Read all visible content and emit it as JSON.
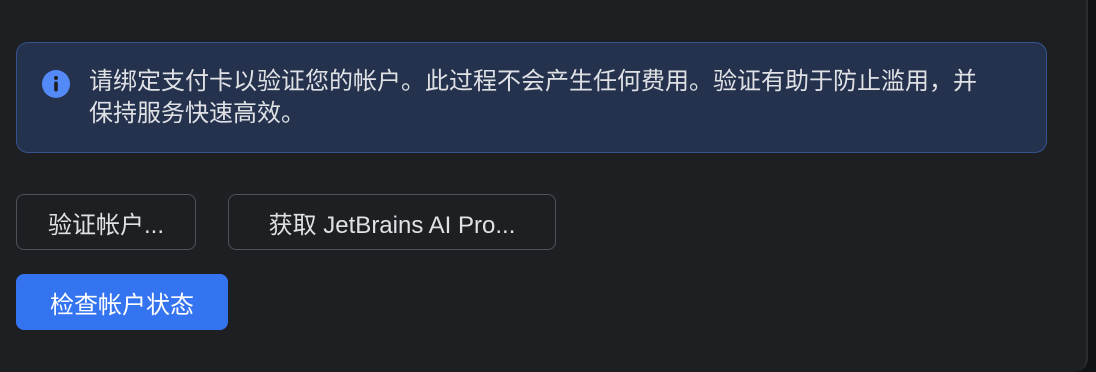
{
  "banner": {
    "icon": "info-icon",
    "text": "请绑定支付卡以验证您的帐户。此过程不会产生任何费用。验证有助于防止滥用，并保持服务快速高效。"
  },
  "buttons": {
    "verify_account": "验证帐户...",
    "get_ai_pro": "获取 JetBrains AI Pro...",
    "check_status": "检查帐户状态"
  },
  "colors": {
    "background": "#1e1f22",
    "banner_bg": "#25324d",
    "banner_border": "#35538f",
    "info_icon": "#548af7",
    "primary": "#3574f0",
    "text": "#dfe1e5"
  }
}
